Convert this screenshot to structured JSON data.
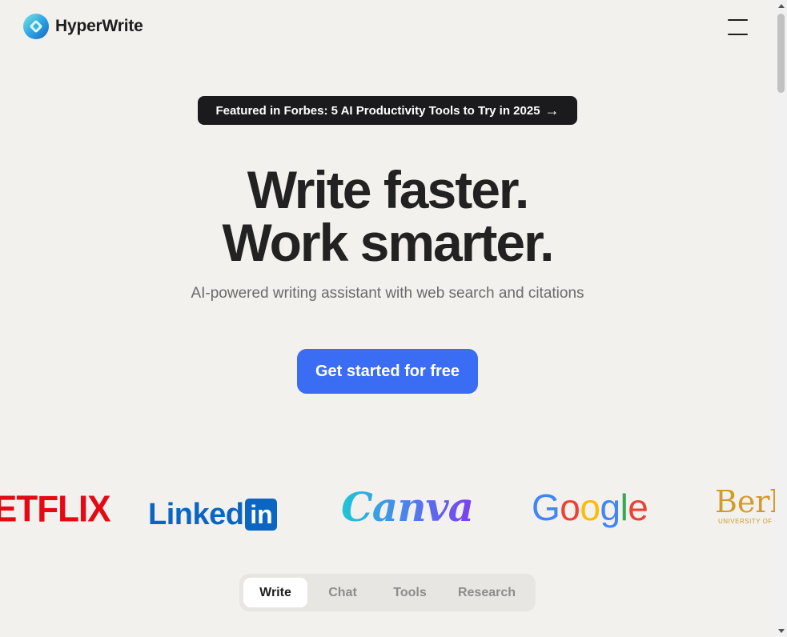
{
  "header": {
    "brand_name": "HyperWrite",
    "logo_icon": "hyperwrite-logo-icon",
    "menu_icon": "hamburger-menu-icon"
  },
  "featured": {
    "label": "Featured in Forbes: 5 AI Productivity Tools to Try in 2025",
    "arrow": "→"
  },
  "hero": {
    "line1": "Write faster.",
    "line2": "Work smarter.",
    "subtitle": "AI-powered writing assistant with web search and citations",
    "cta_label": "Get started for free"
  },
  "logos": {
    "netflix": "ETFLIX",
    "linkedin_text": "Linked",
    "linkedin_badge": "in",
    "canva": "Canva",
    "google": [
      "G",
      "o",
      "o",
      "g",
      "l",
      "e"
    ],
    "berkeley": "Berk",
    "berkeley_sub": "UNIVERSITY OF C"
  },
  "tabs": [
    {
      "label": "Write",
      "active": true
    },
    {
      "label": "Chat",
      "active": false
    },
    {
      "label": "Tools",
      "active": false
    },
    {
      "label": "Research",
      "active": false
    }
  ],
  "colors": {
    "background": "#f2f1ee",
    "cta": "#3a6cf4",
    "pill": "#1b1b1d"
  }
}
